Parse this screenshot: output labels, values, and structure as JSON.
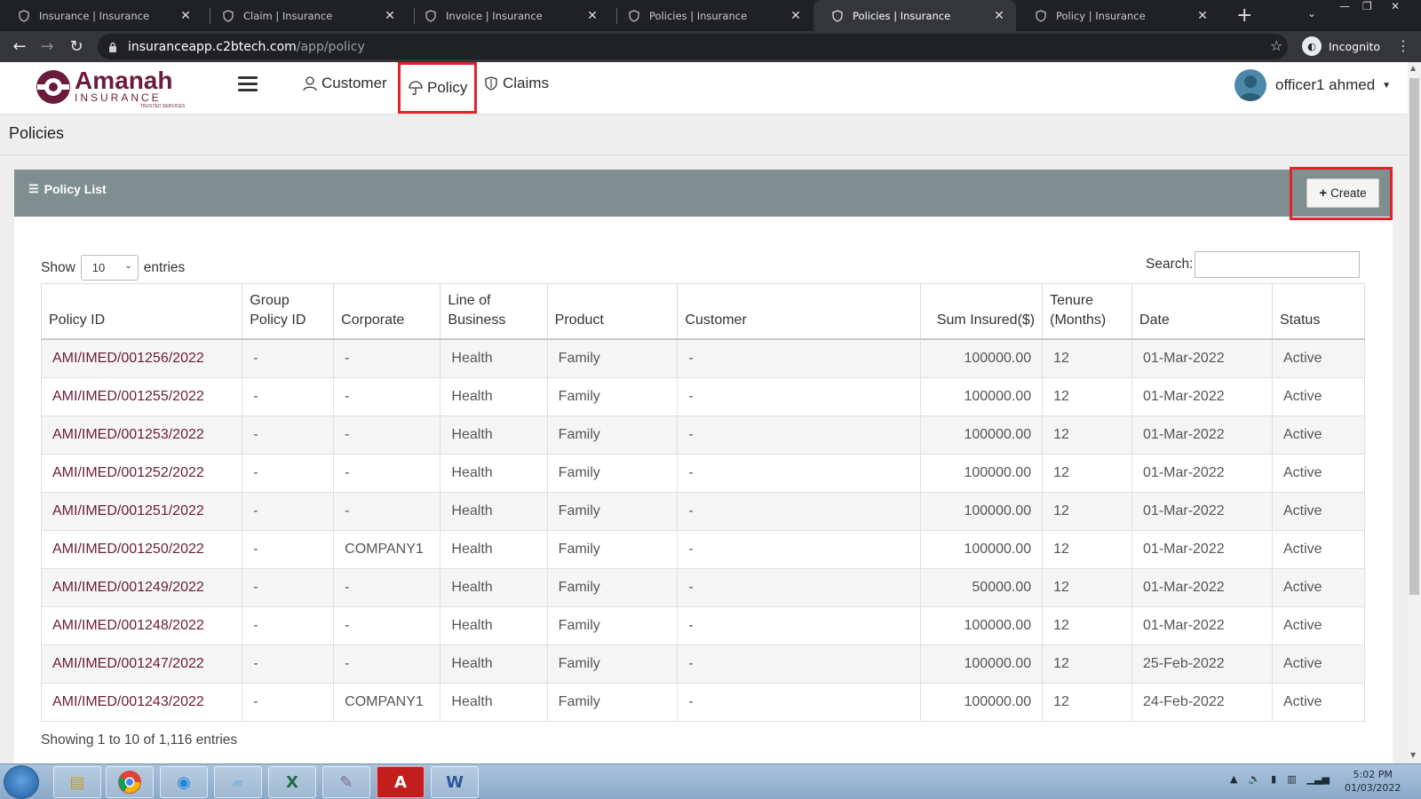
{
  "browser": {
    "tabs": [
      {
        "title": "Insurance | Insurance"
      },
      {
        "title": "Claim | Insurance"
      },
      {
        "title": "Invoice | Insurance"
      },
      {
        "title": "Policies | Insurance"
      },
      {
        "title": "Policies | Insurance"
      },
      {
        "title": "Policy | Insurance"
      }
    ],
    "url_host": "insuranceapp.c2btech.com",
    "url_path": "/app/policy",
    "incognito_label": "Incognito"
  },
  "header": {
    "logo_text": "Amanah",
    "logo_subtext": "INSURANCE",
    "logo_tagline": "TRUSTED SERVICES",
    "nav": [
      {
        "label": "Customer",
        "icon": "user-icon"
      },
      {
        "label": "Policy",
        "icon": "umbrella-icon"
      },
      {
        "label": "Claims",
        "icon": "shield-icon"
      }
    ],
    "user_name": "officer1 ahmed"
  },
  "page": {
    "title": "Policies",
    "card_title": "Policy List",
    "create_label": "Create",
    "show_label": "Show",
    "entries_label": "entries",
    "page_size": "10",
    "search_label": "Search:",
    "info": "Showing 1 to 10 of 1,116 entries"
  },
  "table": {
    "headers": [
      "Policy ID",
      "Group Policy ID",
      "Corporate",
      "Line of Business",
      "Product",
      "Customer",
      "Sum Insured($)",
      "Tenure (Months)",
      "Date",
      "Status"
    ],
    "rows": [
      [
        "AMI/IMED/001256/2022",
        "-",
        "-",
        "Health",
        "Family",
        "-",
        "100000.00",
        "12",
        "01-Mar-2022",
        "Active"
      ],
      [
        "AMI/IMED/001255/2022",
        "-",
        "-",
        "Health",
        "Family",
        "-",
        "100000.00",
        "12",
        "01-Mar-2022",
        "Active"
      ],
      [
        "AMI/IMED/001253/2022",
        "-",
        "-",
        "Health",
        "Family",
        "-",
        "100000.00",
        "12",
        "01-Mar-2022",
        "Active"
      ],
      [
        "AMI/IMED/001252/2022",
        "-",
        "-",
        "Health",
        "Family",
        "-",
        "100000.00",
        "12",
        "01-Mar-2022",
        "Active"
      ],
      [
        "AMI/IMED/001251/2022",
        "-",
        "-",
        "Health",
        "Family",
        "-",
        "100000.00",
        "12",
        "01-Mar-2022",
        "Active"
      ],
      [
        "AMI/IMED/001250/2022",
        "-",
        "COMPANY1",
        "Health",
        "Family",
        "-",
        "100000.00",
        "12",
        "01-Mar-2022",
        "Active"
      ],
      [
        "AMI/IMED/001249/2022",
        "-",
        "-",
        "Health",
        "Family",
        "-",
        "50000.00",
        "12",
        "01-Mar-2022",
        "Active"
      ],
      [
        "AMI/IMED/001248/2022",
        "-",
        "-",
        "Health",
        "Family",
        "-",
        "100000.00",
        "12",
        "01-Mar-2022",
        "Active"
      ],
      [
        "AMI/IMED/001247/2022",
        "-",
        "-",
        "Health",
        "Family",
        "-",
        "100000.00",
        "12",
        "25-Feb-2022",
        "Active"
      ],
      [
        "AMI/IMED/001243/2022",
        "-",
        "COMPANY1",
        "Health",
        "Family",
        "-",
        "100000.00",
        "12",
        "24-Feb-2022",
        "Active"
      ]
    ]
  },
  "taskbar": {
    "time": "5:02 PM",
    "date": "01/03/2022"
  },
  "colors": {
    "brand": "#6b1b3b",
    "card_header": "#7f8e8e",
    "highlight": "#e3212a"
  }
}
